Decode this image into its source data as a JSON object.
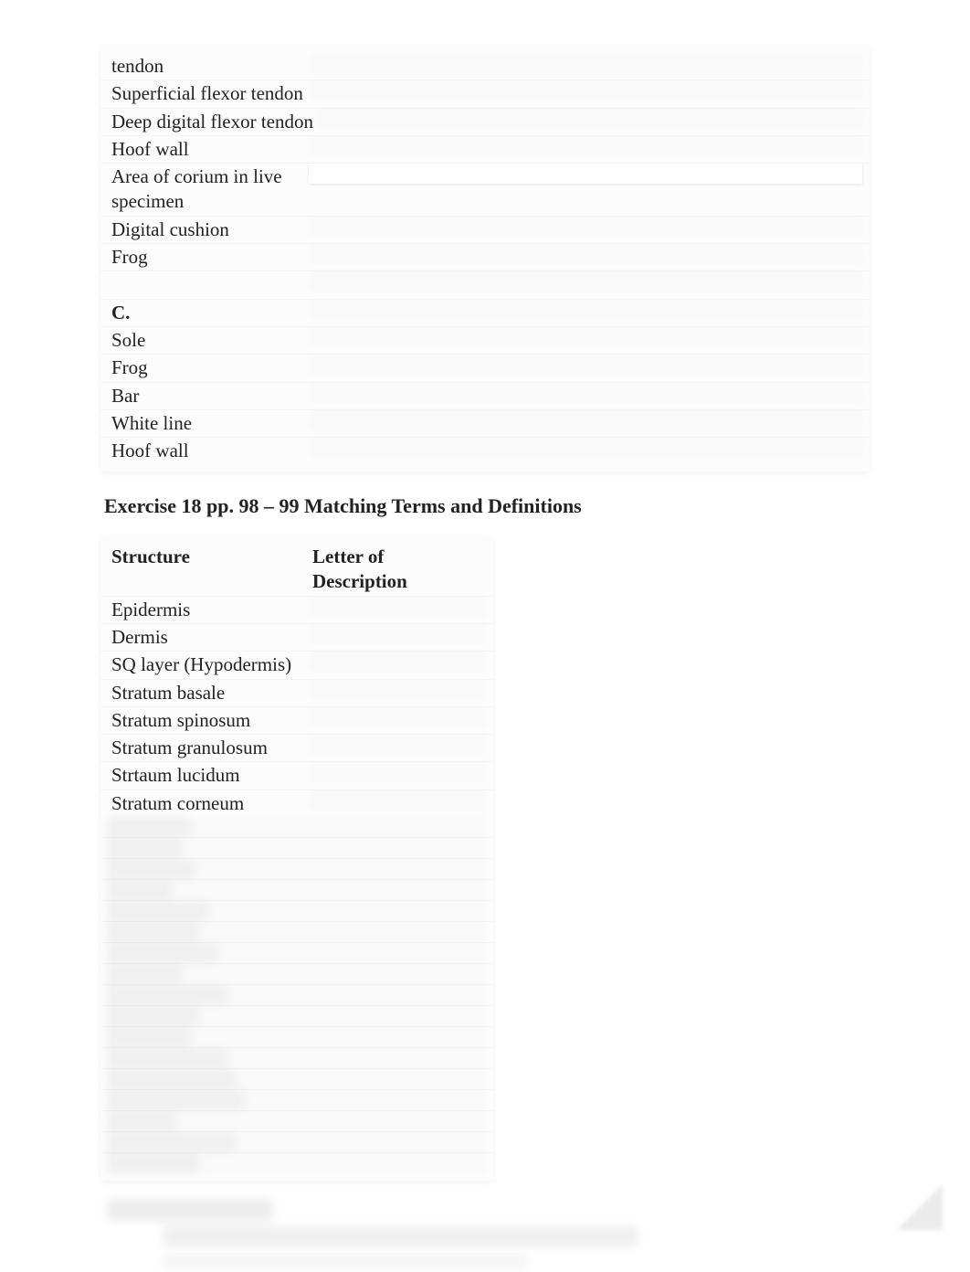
{
  "listA": {
    "items": [
      "tendon",
      "Superficial flexor tendon",
      "Deep digital flexor tendon",
      "Hoof wall",
      "Area of corium in live specimen",
      "Digital cushion",
      "Frog"
    ]
  },
  "listC": {
    "label": "C.",
    "items": [
      "Sole",
      "Frog",
      "Bar",
      "White line",
      "Hoof wall"
    ]
  },
  "exerciseHeading": "Exercise 18 pp. 98 – 99 Matching Terms and Definitions",
  "matchingTable": {
    "headers": {
      "left": "Structure",
      "right": "Letter of Description"
    },
    "visibleItems": [
      "Epidermis",
      "Dermis",
      "SQ layer (Hypodermis)",
      "Stratum basale",
      "Stratum spinosum",
      "Stratum granulosum",
      "Strtaum lucidum",
      "Stratum corneum"
    ],
    "blurredCount": 17
  }
}
